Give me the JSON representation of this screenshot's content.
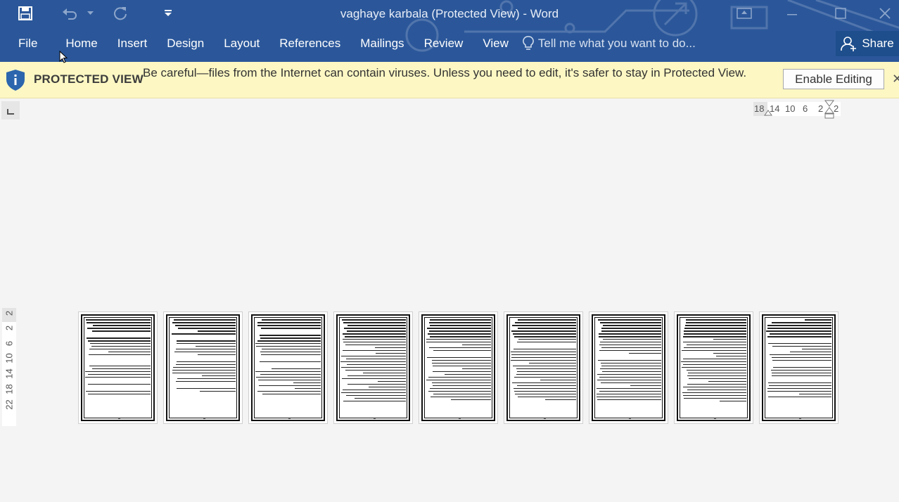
{
  "window": {
    "title": "vaghaye karbala (Protected View) - Word"
  },
  "quick_access": {
    "icons": [
      "save-icon",
      "undo-icon",
      "undo-dropdown-icon",
      "redo-icon",
      "customize-qat-icon"
    ]
  },
  "window_controls": {
    "icons": [
      "ribbon-display-options-icon",
      "minimize-icon",
      "maximize-icon",
      "close-icon"
    ]
  },
  "ribbon": {
    "file": "File",
    "tabs": [
      "Home",
      "Insert",
      "Design",
      "Layout",
      "References",
      "Mailings",
      "Review",
      "View"
    ],
    "tell_me_placeholder": "Tell me what you want to do...",
    "share": "Share"
  },
  "protected_view": {
    "label": "PROTECTED VIEW",
    "message": "Be careful—files from the Internet can contain viruses. Unless you need to edit, it's safer to stay in Protected View.",
    "enable_button": "Enable Editing",
    "close_glyph": "✕"
  },
  "horizontal_ruler": {
    "ticks": [
      "18",
      "14",
      "10",
      "6",
      "2",
      "2"
    ]
  },
  "vertical_ruler": {
    "ticks": [
      "2",
      "2",
      "6",
      "10",
      "14",
      "18",
      "22"
    ]
  },
  "document": {
    "page_count": 9
  },
  "colors": {
    "ribbon": "#2b579a",
    "protected_bar": "#fcf7c3",
    "canvas": "#f4f4f4"
  }
}
